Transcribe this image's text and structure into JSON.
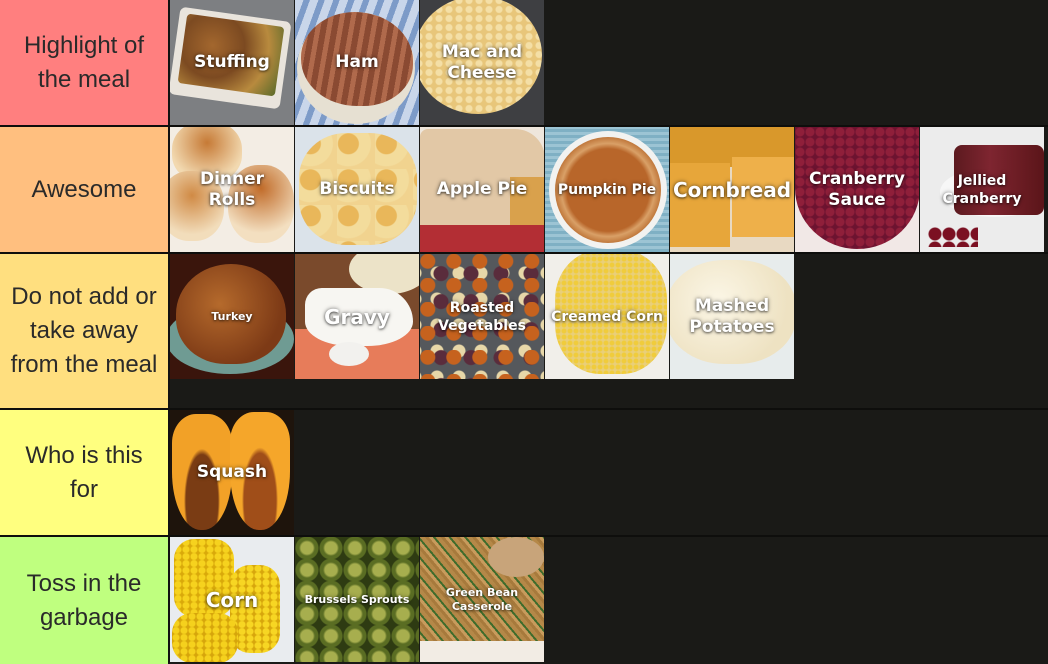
{
  "tiers": [
    {
      "label": "Highlight of the meal",
      "color": "#ff7f7f",
      "items": [
        {
          "name": "Stuffing",
          "image": "stuffing-photo"
        },
        {
          "name": "Ham",
          "image": "ham-photo"
        },
        {
          "name": "Mac and Cheese",
          "image": "mac-and-cheese-photo"
        }
      ]
    },
    {
      "label": "Awesome",
      "color": "#ffbf7f",
      "items": [
        {
          "name": "Dinner Rolls",
          "image": "dinner-rolls-photo"
        },
        {
          "name": "Biscuits",
          "image": "biscuits-photo"
        },
        {
          "name": "Apple Pie",
          "image": "apple-pie-photo"
        },
        {
          "name": "Pumpkin Pie",
          "image": "pumpkin-pie-photo"
        },
        {
          "name": "Cornbread",
          "image": "cornbread-photo"
        },
        {
          "name": "Cranberry Sauce",
          "image": "cranberry-sauce-photo"
        },
        {
          "name": "Jellied Cranberry",
          "image": "jellied-cranberry-photo"
        }
      ]
    },
    {
      "label": "Do not add or take away from the meal",
      "color": "#ffdf7f",
      "items": [
        {
          "name": "Turkey",
          "image": "turkey-photo"
        },
        {
          "name": "Gravy",
          "image": "gravy-photo"
        },
        {
          "name": "Roasted Vegetables",
          "image": "roasted-vegetables-photo"
        },
        {
          "name": "Creamed Corn",
          "image": "creamed-corn-photo"
        },
        {
          "name": "Mashed Potatoes",
          "image": "mashed-potatoes-photo"
        }
      ]
    },
    {
      "label": "Who is this for",
      "color": "#ffff7f",
      "items": [
        {
          "name": "Squash",
          "image": "squash-photo"
        }
      ]
    },
    {
      "label": "Toss in the garbage",
      "color": "#bfff7f",
      "items": [
        {
          "name": "Corn",
          "image": "corn-photo"
        },
        {
          "name": "Brussels Sprouts",
          "image": "brussels-sprouts-photo"
        },
        {
          "name": "Green Bean Casserole",
          "image": "green-bean-casserole-photo"
        }
      ]
    }
  ]
}
